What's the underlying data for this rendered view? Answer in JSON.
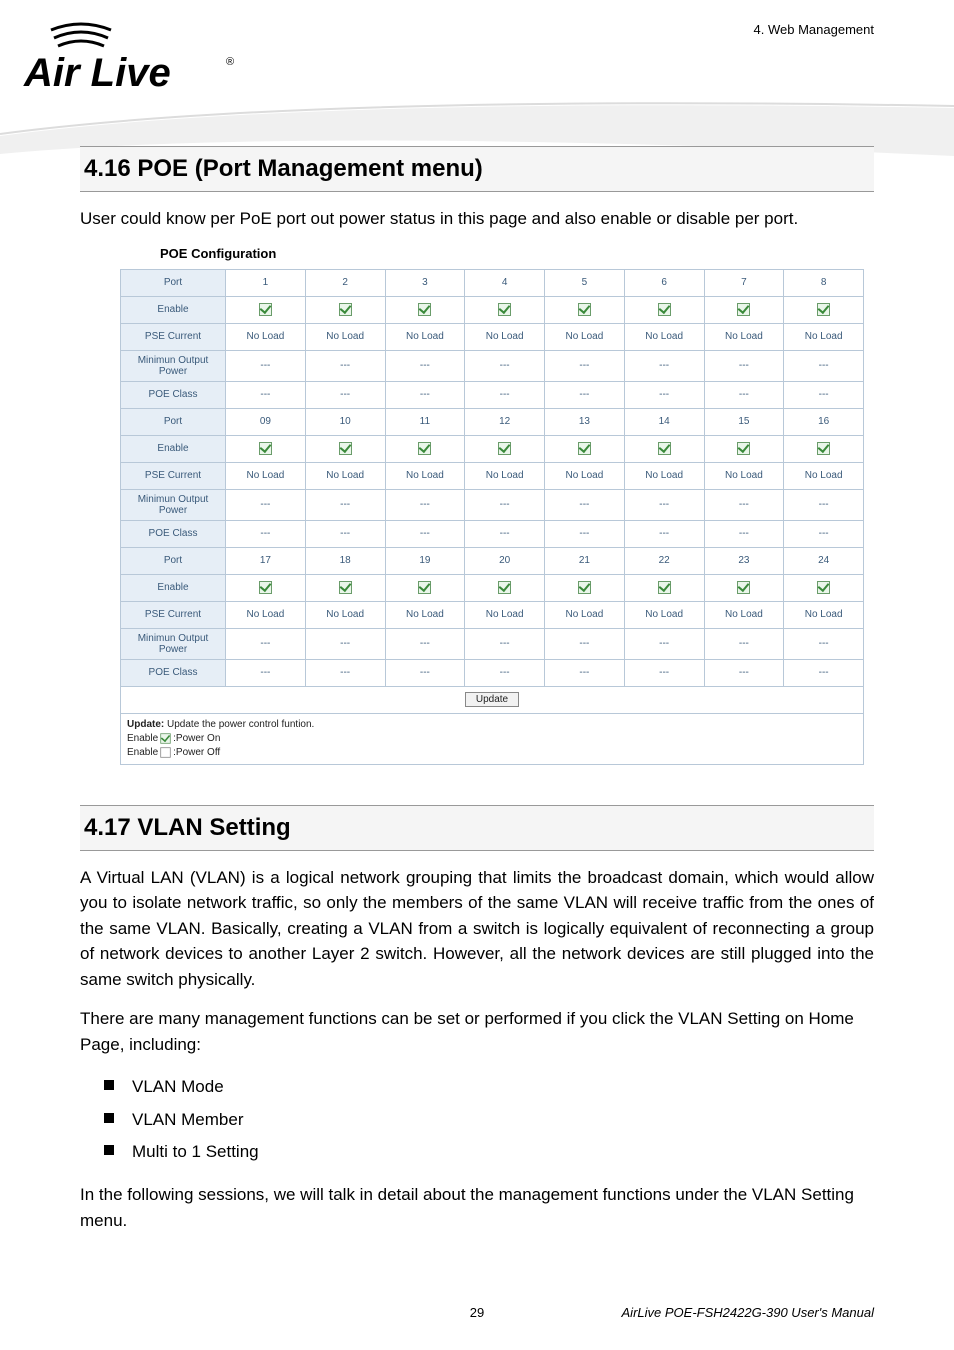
{
  "chapter_top": "4. Web Management",
  "logo_text": "Air Live",
  "section_416_title": "4.16 POE (Port Management menu)",
  "section_416_body": "User could know per PoE port out power status in this page and also enable or disable per port.",
  "poe_caption": "POE Configuration",
  "poe_table": {
    "row_labels": [
      "Port",
      "Enable",
      "PSE Current",
      "Minimun Output Power",
      "POE Class"
    ],
    "groups": [
      {
        "ports": [
          "1",
          "2",
          "3",
          "4",
          "5",
          "6",
          "7",
          "8"
        ]
      },
      {
        "ports": [
          "09",
          "10",
          "11",
          "12",
          "13",
          "14",
          "15",
          "16"
        ]
      },
      {
        "ports": [
          "17",
          "18",
          "19",
          "20",
          "21",
          "22",
          "23",
          "24"
        ]
      }
    ],
    "pse_value": "No Load",
    "dash": "---",
    "update_label": "Update"
  },
  "legend": {
    "l1a": "Update:",
    "l1b": " Update the power control funtion.",
    "l2": "Enable",
    "l2b": ":Power On",
    "l3": "Enable",
    "l3b": ":Power Off"
  },
  "section_417_title": "4.17 VLAN Setting",
  "section_417_p1": "A Virtual LAN (VLAN) is a logical network grouping that limits the broadcast domain, which would allow you to isolate network traffic, so only the members of the same VLAN will receive traffic from the ones of the same VLAN. Basically, creating a VLAN from a switch is logically equivalent of reconnecting a group of network devices to another Layer 2 switch. However, all the network devices are still plugged into the same switch physically.",
  "section_417_p2": "There are many management functions can be set or performed if you click the VLAN Setting on Home Page, including:",
  "bullets": [
    "VLAN Mode",
    "VLAN Member",
    "Multi to 1 Setting"
  ],
  "section_417_p3": "In the following sessions, we will talk in detail about the management functions under the VLAN Setting menu.",
  "footer": {
    "page_no": "29",
    "manual": "AirLive POE-FSH2422G-390 User's Manual"
  }
}
